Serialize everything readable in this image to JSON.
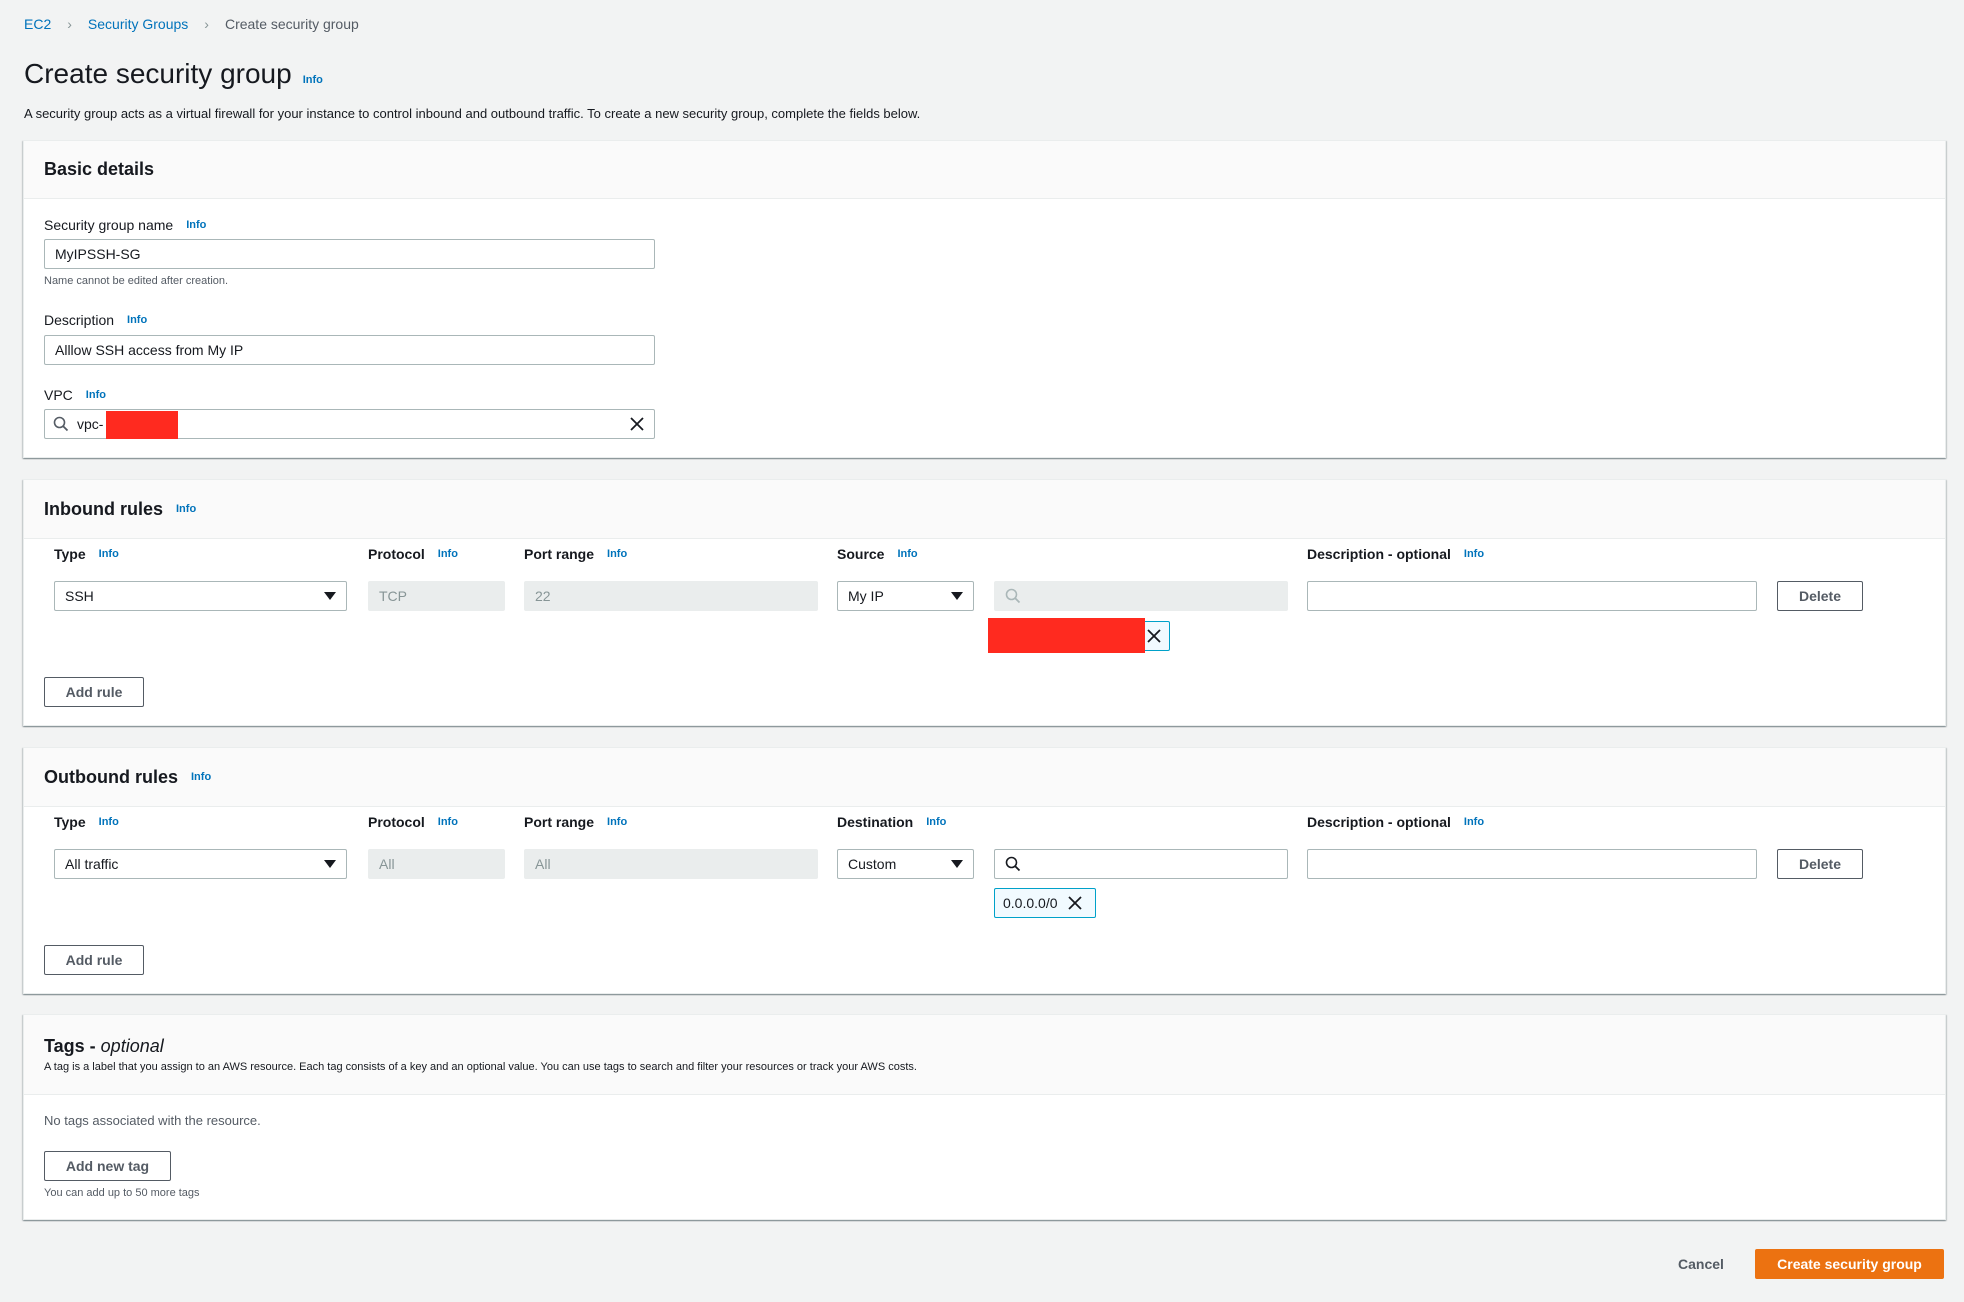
{
  "breadcrumb": {
    "items": [
      "EC2",
      "Security Groups"
    ],
    "current": "Create security group"
  },
  "page": {
    "title": "Create security group",
    "info": "Info",
    "description": "A security group acts as a virtual firewall for your instance to control inbound and outbound traffic. To create a new security group, complete the fields below."
  },
  "basic": {
    "title": "Basic details",
    "name_label": "Security group name",
    "name_value": "MyIPSSH-SG",
    "name_hint": "Name cannot be edited after creation.",
    "desc_label": "Description",
    "desc_value": "Alllow SSH access from My IP",
    "vpc_label": "VPC",
    "vpc_value": "vpc-"
  },
  "inbound": {
    "title": "Inbound rules",
    "headers": {
      "type": "Type",
      "protocol": "Protocol",
      "port": "Port range",
      "source": "Source",
      "desc": "Description - optional"
    },
    "row": {
      "type": "SSH",
      "protocol": "TCP",
      "port": "22",
      "source": "My IP"
    },
    "delete": "Delete",
    "add_rule": "Add rule"
  },
  "outbound": {
    "title": "Outbound rules",
    "headers": {
      "type": "Type",
      "protocol": "Protocol",
      "port": "Port range",
      "destination": "Destination",
      "desc": "Description - optional"
    },
    "row": {
      "type": "All traffic",
      "protocol": "All",
      "port": "All",
      "destination": "Custom",
      "token": "0.0.0.0/0"
    },
    "delete": "Delete",
    "add_rule": "Add rule"
  },
  "tags": {
    "title": "Tags - ",
    "title_italic": "optional",
    "description": "A tag is a label that you assign to an AWS resource. Each tag consists of a key and an optional value. You can use tags to search and filter your resources or track your AWS costs.",
    "empty": "No tags associated with the resource.",
    "add": "Add new tag",
    "hint": "You can add up to 50 more tags"
  },
  "footer": {
    "cancel": "Cancel",
    "create": "Create security group"
  },
  "colors": {
    "accent": "#ec7211",
    "link": "#0073bb",
    "redaction": "#ff2a1f"
  }
}
